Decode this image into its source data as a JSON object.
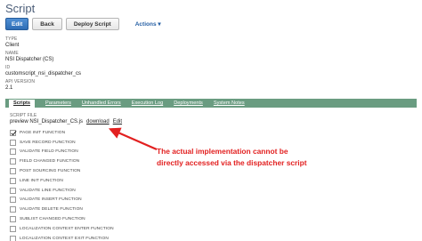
{
  "page": {
    "title": "Script"
  },
  "toolbar": {
    "edit_label": "Edit",
    "back_label": "Back",
    "deploy_label": "Deploy Script",
    "actions_label": "Actions ▾"
  },
  "fields": {
    "type_label": "TYPE",
    "type_value": "Client",
    "name_label": "NAME",
    "name_value": "NSI Dispatcher (CS)",
    "id_label": "ID",
    "id_value": "customscript_nsi_dispatcher_cs",
    "api_label": "API VERSION",
    "api_value": "2.1"
  },
  "tabs": [
    {
      "label": "Scripts"
    },
    {
      "label": "Parameters"
    },
    {
      "label": "Unhandled Errors"
    },
    {
      "label": "Execution Log"
    },
    {
      "label": "Deployments"
    },
    {
      "label": "System Notes"
    }
  ],
  "script_file": {
    "label": "SCRIPT FILE",
    "value": "preview NSI_Dispatcher_CS.js",
    "download_label": "download",
    "edit_label": "Edit"
  },
  "functions": [
    {
      "label": "PAGE INIT FUNCTION",
      "checked": true
    },
    {
      "label": "SAVE RECORD FUNCTION",
      "checked": false
    },
    {
      "label": "VALIDATE FIELD FUNCTION",
      "checked": false
    },
    {
      "label": "FIELD CHANGED FUNCTION",
      "checked": false
    },
    {
      "label": "POST SOURCING FUNCTION",
      "checked": false
    },
    {
      "label": "LINE INIT FUNCTION",
      "checked": false
    },
    {
      "label": "VALIDATE LINE FUNCTION",
      "checked": false
    },
    {
      "label": "VALIDATE INSERT FUNCTION",
      "checked": false
    },
    {
      "label": "VALIDATE DELETE FUNCTION",
      "checked": false
    },
    {
      "label": "SUBLIST CHANGED FUNCTION",
      "checked": false
    },
    {
      "label": "LOCALIZATION CONTEXT ENTER FUNCTION",
      "checked": false
    },
    {
      "label": "LOCALIZATION CONTEXT EXIT FUNCTION",
      "checked": false
    }
  ],
  "annotation": {
    "line1": "The actual implementation cannot be",
    "line2": "directly accessed via the dispatcher script"
  },
  "colors": {
    "title": "#4d5f79",
    "tabbar": "#6a9c81",
    "primary_button": "#2f6db5",
    "link": "#255fa4",
    "annotation": "#e22020"
  }
}
